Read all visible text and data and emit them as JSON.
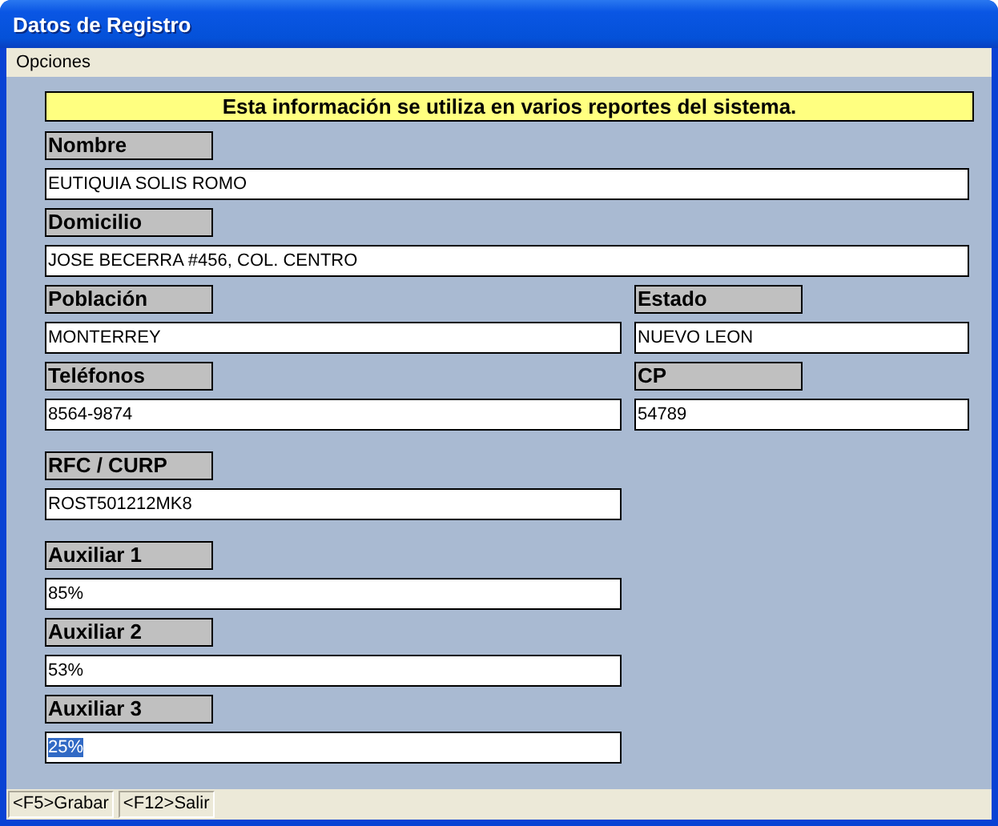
{
  "window": {
    "title": "Datos de Registro"
  },
  "menu": [
    {
      "label": "Opciones"
    }
  ],
  "banner": "Esta información se utiliza en varios reportes del sistema.",
  "sections": [
    {
      "rows": [
        {
          "fields": [
            {
              "label": "Nombre",
              "value": "EUTIQUIA SOLIS ROMO",
              "kind": "wide",
              "highlighted": false
            }
          ]
        },
        {
          "fields": [
            {
              "label": "Domicilio",
              "value": "JOSE BECERRA #456, COL. CENTRO",
              "kind": "wide",
              "highlighted": false
            }
          ]
        },
        {
          "fields": [
            {
              "label": "Población",
              "value": "MONTERREY",
              "kind": "half",
              "highlighted": false
            },
            {
              "label": "Estado",
              "value": "NUEVO LEON",
              "kind": "half",
              "highlighted": false
            }
          ]
        },
        {
          "fields": [
            {
              "label": "Teléfonos",
              "value": "8564-9874",
              "kind": "half",
              "highlighted": false
            },
            {
              "label": "CP",
              "value": "54789",
              "kind": "half",
              "highlighted": false
            }
          ]
        }
      ]
    },
    {
      "rows": [
        {
          "fields": [
            {
              "label": "RFC / CURP",
              "value": "ROST501212MK8",
              "kind": "half",
              "highlighted": false
            }
          ]
        }
      ]
    },
    {
      "rows": [
        {
          "fields": [
            {
              "label": "Auxiliar 1",
              "value": "85%",
              "kind": "half",
              "highlighted": false
            }
          ]
        },
        {
          "fields": [
            {
              "label": "Auxiliar 2",
              "value": "53%",
              "kind": "half",
              "highlighted": false
            }
          ]
        },
        {
          "fields": [
            {
              "label": "Auxiliar 3",
              "value": "25%",
              "kind": "half",
              "highlighted": true
            }
          ]
        }
      ]
    }
  ],
  "status_bar": [
    {
      "label": "<F5>Grabar"
    },
    {
      "label": "<F12>Salir"
    }
  ]
}
